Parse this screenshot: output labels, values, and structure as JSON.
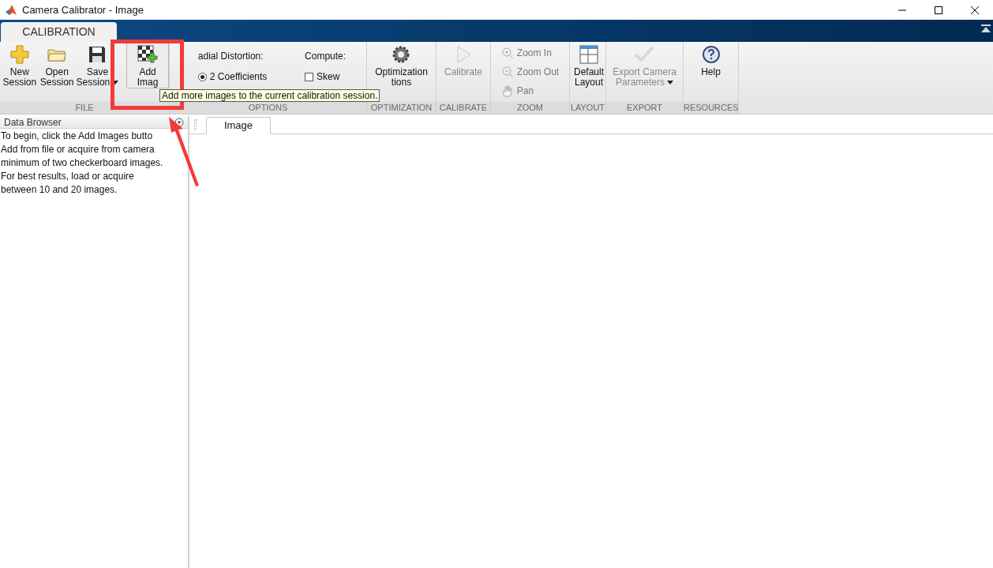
{
  "window": {
    "title": "Camera Calibrator - Image"
  },
  "ribbon_tab": {
    "label": "CALIBRATION",
    "selected": true
  },
  "groups": [
    {
      "label": "FILE",
      "items": [
        {
          "kind": "button",
          "lines": [
            "New",
            "Session"
          ],
          "disabled": false,
          "dropdown": false,
          "hovered": false
        },
        {
          "kind": "button",
          "lines": [
            "Open",
            "Session"
          ],
          "disabled": false,
          "dropdown": false,
          "hovered": false
        },
        {
          "kind": "button",
          "lines": [
            "Save",
            "Session"
          ],
          "disabled": false,
          "dropdown": true,
          "hovered": false
        },
        {
          "kind": "button",
          "lines": [
            "Add",
            "Imag"
          ],
          "disabled": false,
          "dropdown": false,
          "hovered": true
        }
      ]
    },
    {
      "label": "OPTIONS",
      "items": [
        {
          "kind": "options",
          "heading": "adial Distortion:",
          "option": {
            "label": "2 Coefficients",
            "selected": true
          }
        },
        {
          "kind": "checks",
          "heading": "Compute:",
          "option": {
            "label": "Skew",
            "checked": false
          }
        }
      ]
    },
    {
      "label": "OPTIMIZATION",
      "items": [
        {
          "kind": "button",
          "lines": [
            "Optimization",
            "tions"
          ],
          "disabled": false,
          "dropdown": false,
          "hovered": false
        }
      ]
    },
    {
      "label": "CALIBRATE",
      "items": [
        {
          "kind": "button",
          "lines": [
            "Calibrate"
          ],
          "disabled": true,
          "dropdown": false,
          "hovered": false
        }
      ]
    },
    {
      "label": "ZOOM",
      "items": [
        {
          "kind": "stack",
          "entries": [
            {
              "label": "Zoom In",
              "disabled": true
            },
            {
              "label": "Zoom Out",
              "disabled": true
            },
            {
              "label": "Pan",
              "disabled": true
            }
          ]
        }
      ]
    },
    {
      "label": "LAYOUT",
      "items": [
        {
          "kind": "button",
          "lines": [
            "Default",
            "Layout"
          ],
          "disabled": false,
          "dropdown": false,
          "hovered": false
        }
      ]
    },
    {
      "label": "EXPORT",
      "items": [
        {
          "kind": "button",
          "lines": [
            "Export Camera",
            "Parameters"
          ],
          "disabled": true,
          "dropdown": true,
          "hovered": false
        }
      ]
    },
    {
      "label": "RESOURCES",
      "items": [
        {
          "kind": "button",
          "lines": [
            "Help"
          ],
          "disabled": false,
          "dropdown": false,
          "hovered": false
        }
      ]
    }
  ],
  "tooltip": "Add more images to the current calibration session.",
  "data_browser": {
    "title": "Data Browser",
    "text": "To begin, click the Add Images butto\nAdd from file or acquire from camera\nminimum of two checkerboard images.\nFor best results, load or acquire\nbetween 10 and 20 images."
  },
  "document_tabs": [
    {
      "label": "Image",
      "selected": true
    }
  ]
}
